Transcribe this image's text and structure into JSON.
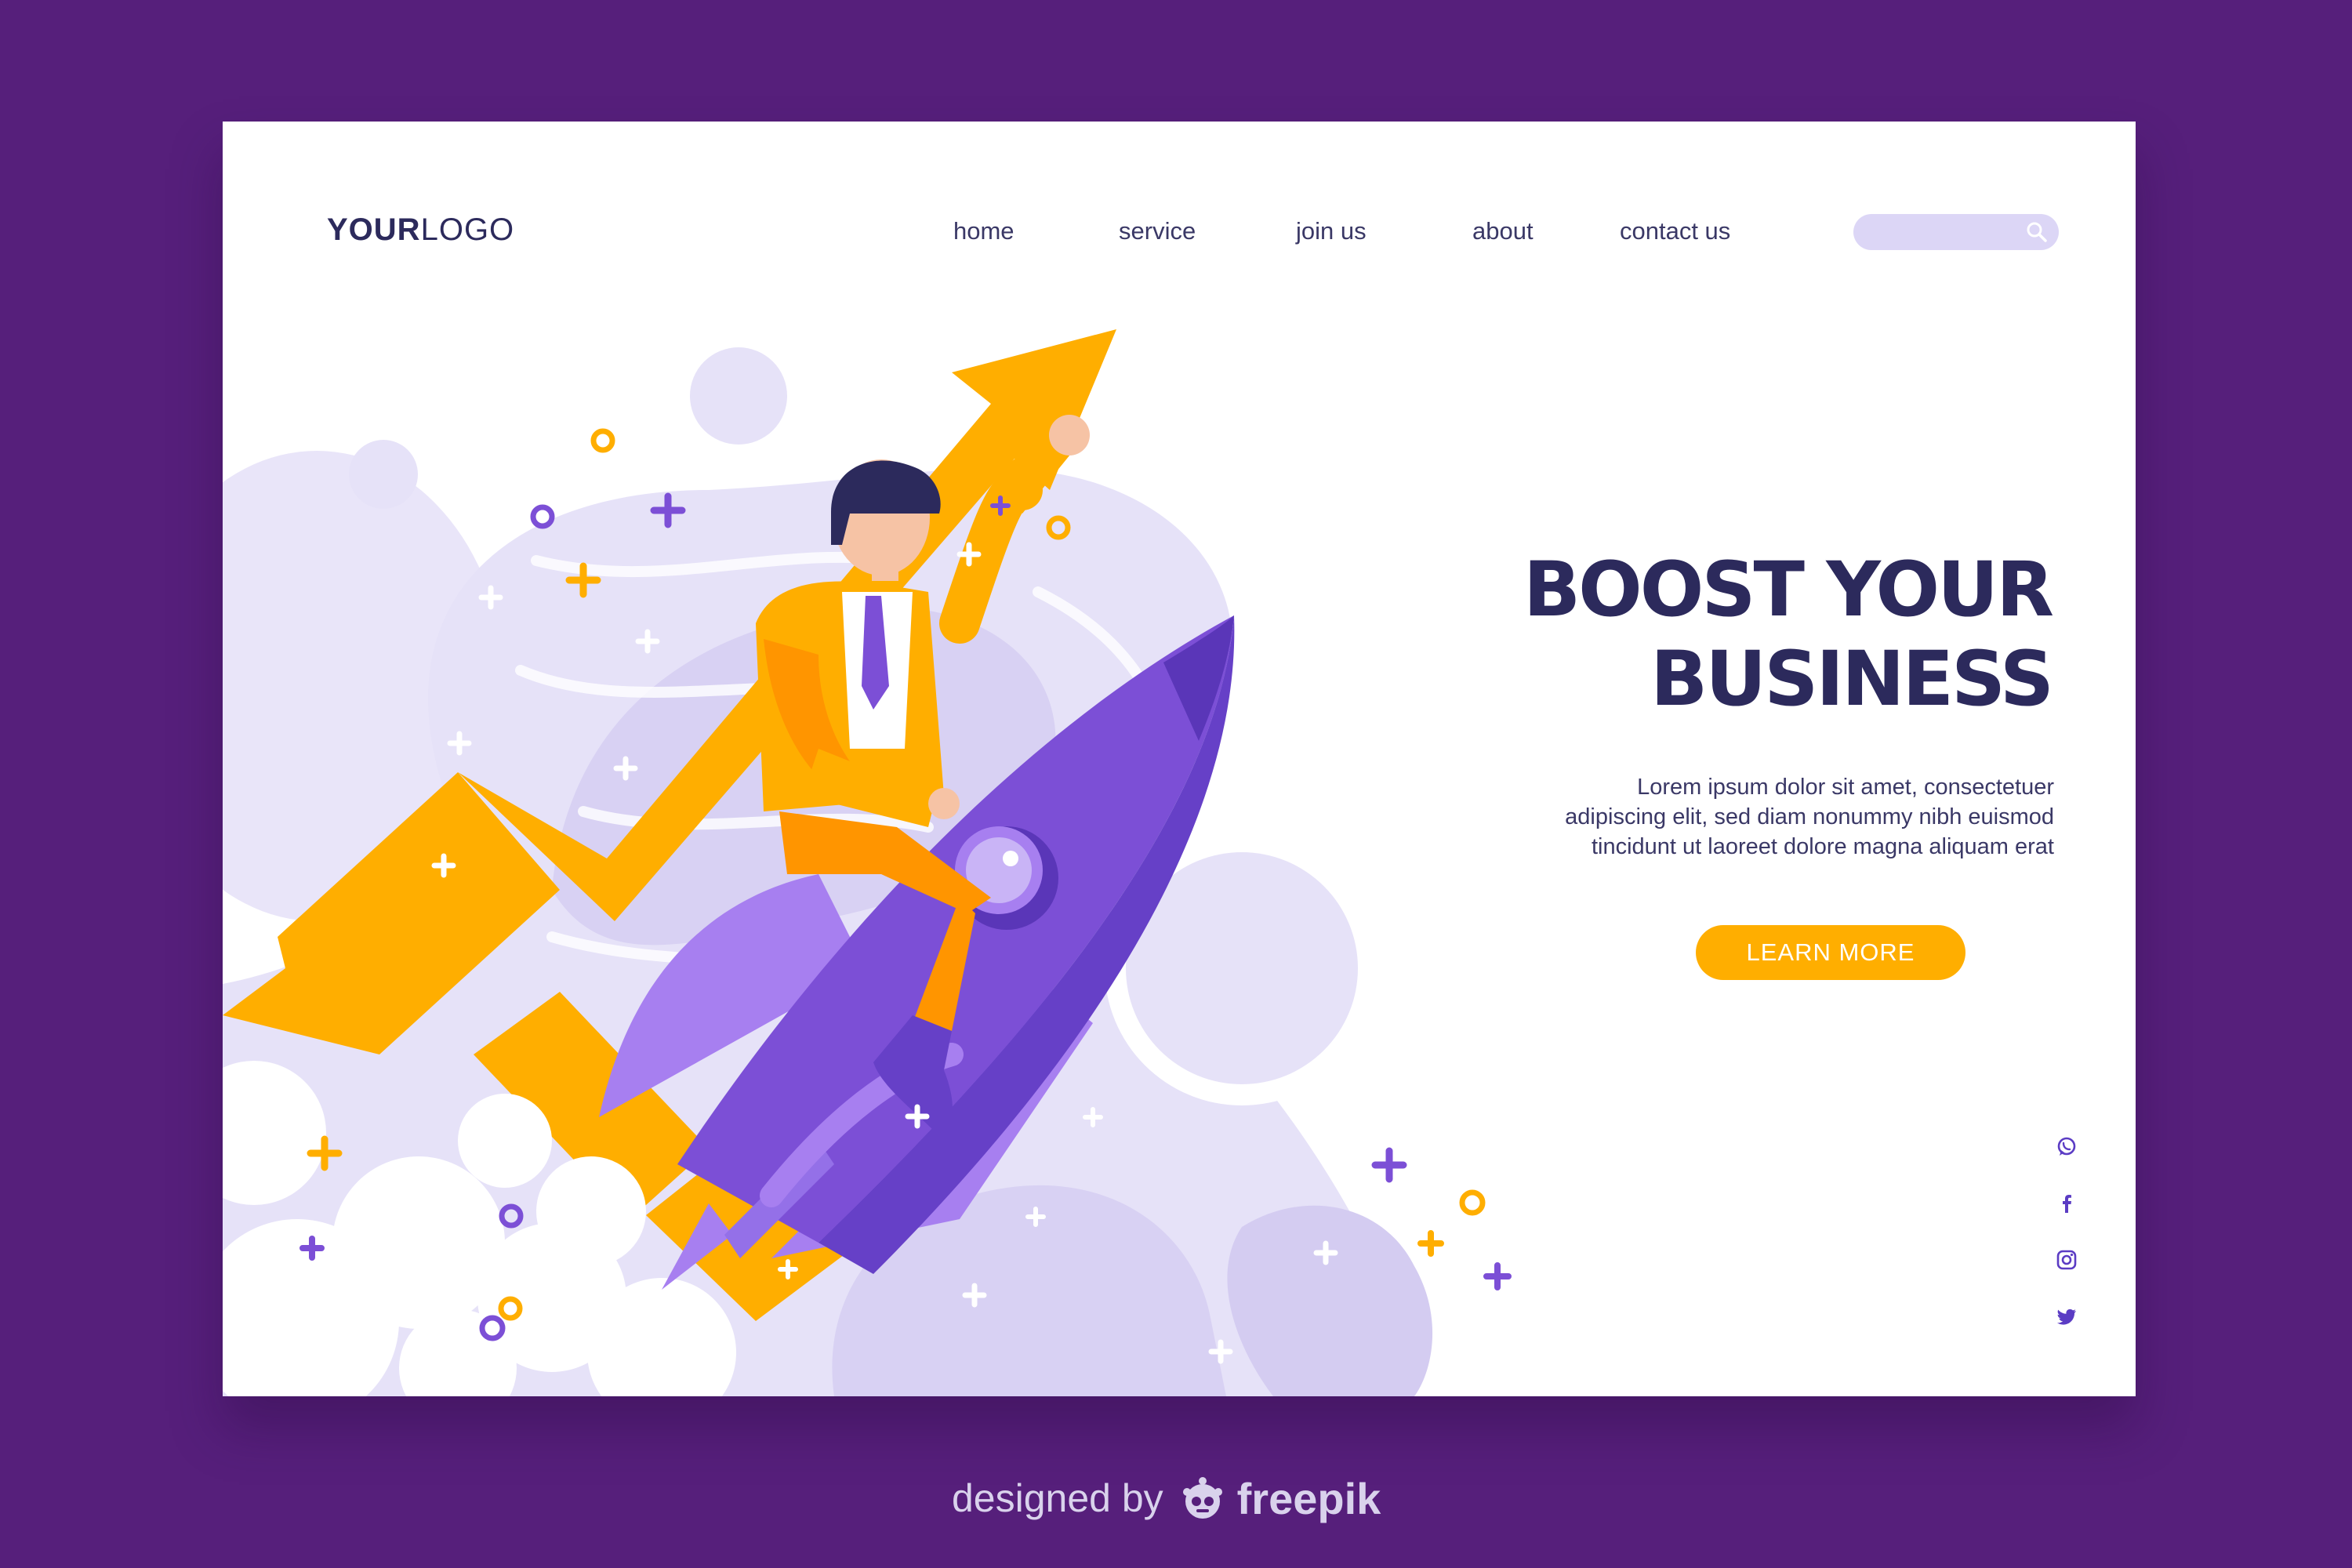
{
  "header": {
    "logo_bold": "YOUR",
    "logo_light": "LOGO",
    "nav": [
      {
        "label": "home"
      },
      {
        "label": "service"
      },
      {
        "label": "join us"
      },
      {
        "label": "about"
      },
      {
        "label": "contact us"
      }
    ],
    "search_placeholder": ""
  },
  "hero": {
    "headline_line1": "BOOST YOUR",
    "headline_line2": "BUSINESS",
    "body_lines": [
      "Lorem ipsum dolor sit amet, consectetuer",
      "adipiscing elit, sed diam nonummy nibh euismod",
      "tincidunt ut laoreet dolore magna aliquam erat"
    ],
    "cta_label": "LEARN MORE"
  },
  "social": [
    "whatsapp-icon",
    "facebook-icon",
    "instagram-icon",
    "twitter-icon"
  ],
  "credit": {
    "designed_by": "designed by",
    "brand": "freepik"
  },
  "colors": {
    "page_background": "#561f7b",
    "card_background": "#ffffff",
    "accent_orange": "#ffae00",
    "rocket_purple": "#7c4fd6",
    "lavender": "#e6e2f8",
    "navy_text": "#2c2a5c",
    "search_background": "#dcd6f6",
    "icon_color": "#5b3cc4"
  }
}
